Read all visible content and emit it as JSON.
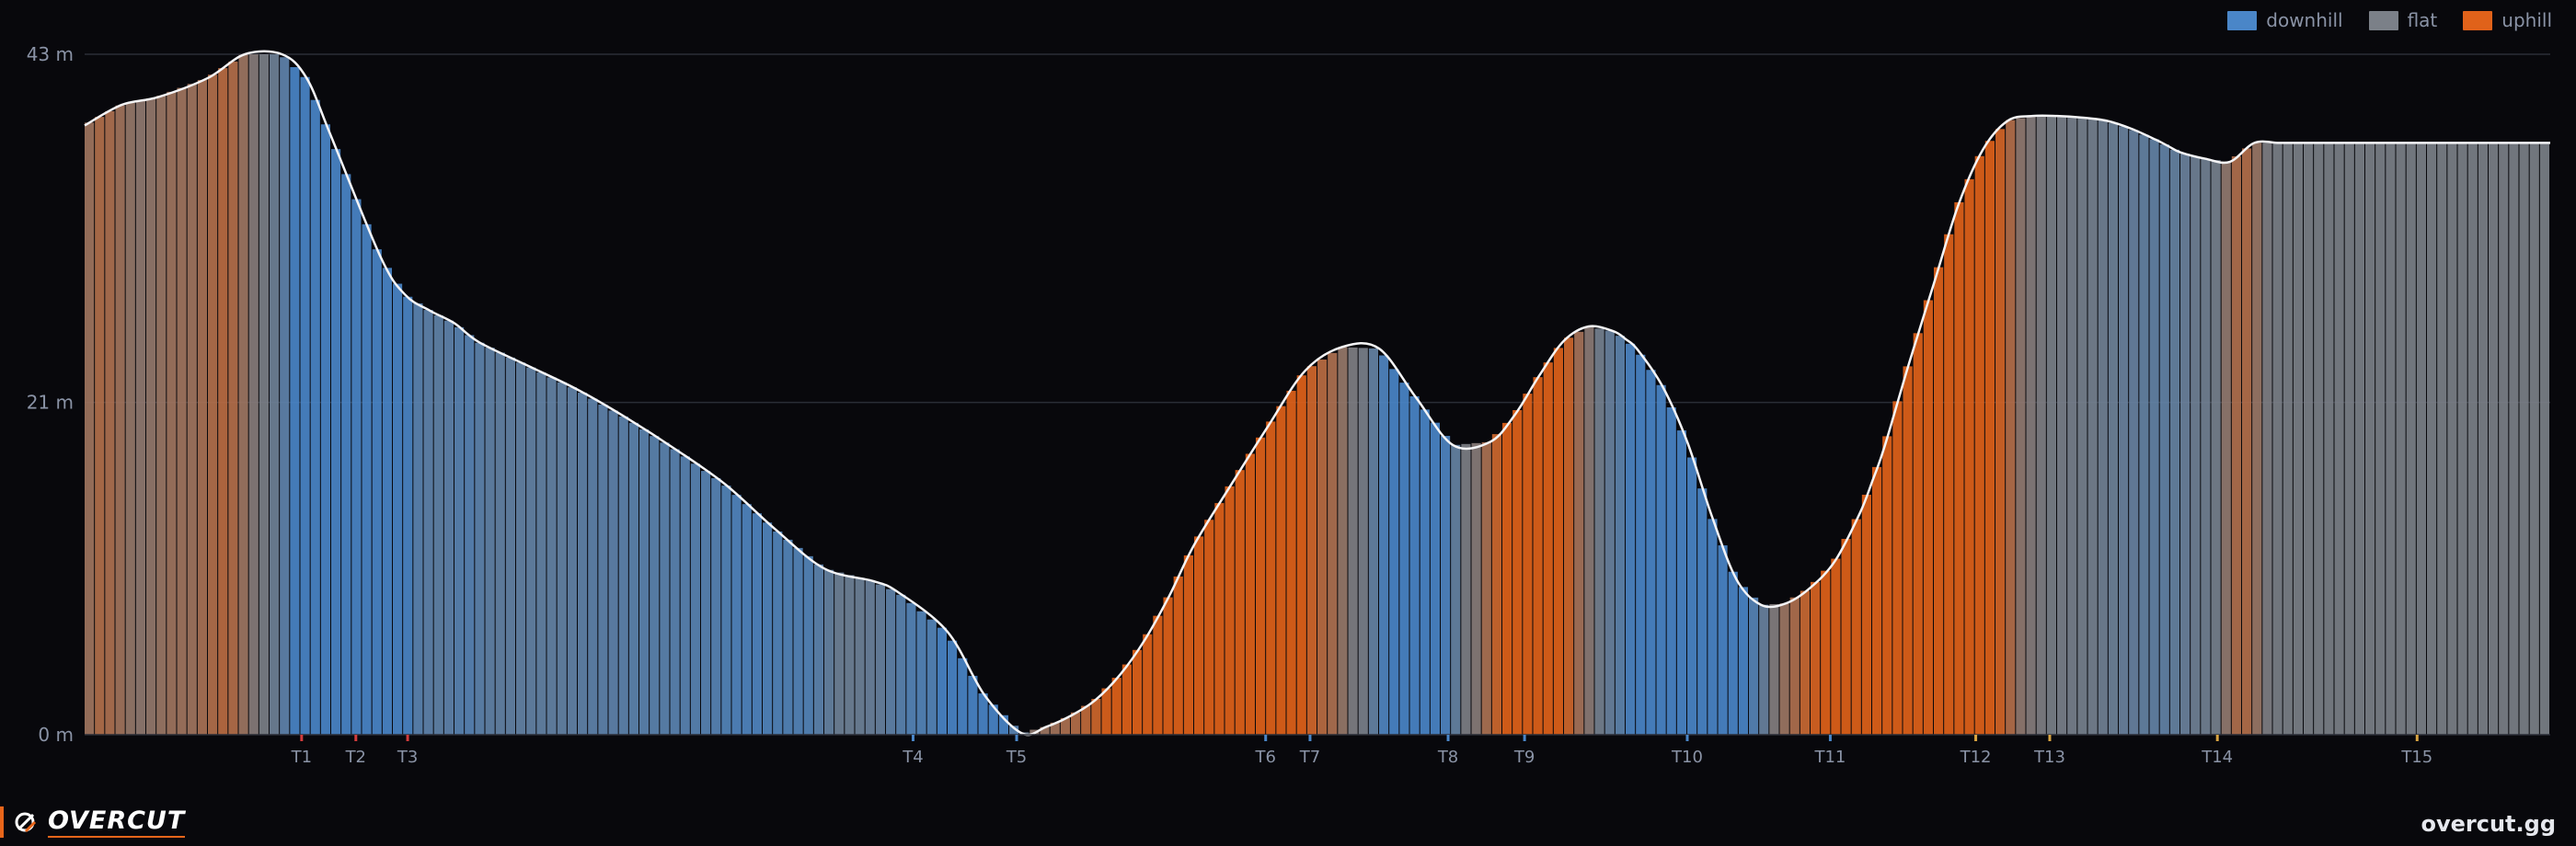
{
  "chart_data": {
    "type": "area",
    "ylim": [
      0,
      43
    ],
    "y_ticks": [
      {
        "value": 0,
        "label": "0 m"
      },
      {
        "value": 21,
        "label": "21 m"
      },
      {
        "value": 43,
        "label": "43 m"
      }
    ],
    "legend": [
      {
        "name": "downhill",
        "color": "#4a86c8"
      },
      {
        "name": "flat",
        "color": "#7b8088"
      },
      {
        "name": "uphill",
        "color": "#e0621a"
      }
    ],
    "legend_position": "top-right",
    "gridlines": true,
    "x_range": [
      0,
      100
    ],
    "profile_x": [
      0,
      1.5,
      3,
      5,
      6.5,
      8,
      9,
      10,
      12,
      13,
      14,
      15,
      16,
      18,
      20,
      22,
      24,
      26,
      28,
      30,
      32,
      33,
      35,
      36.5,
      38,
      39,
      40,
      41,
      42,
      43,
      44,
      45,
      46.5,
      48,
      49.5,
      51,
      52.5,
      54,
      55.5,
      57,
      58,
      59,
      60,
      61,
      62,
      62.5,
      63,
      64,
      65,
      66,
      67,
      68,
      69,
      70,
      71,
      72,
      72.5,
      73,
      74,
      75,
      76,
      77,
      78,
      79,
      80,
      81,
      82,
      83,
      84,
      84.5,
      85,
      86,
      87,
      88,
      89,
      90,
      91,
      92,
      93,
      94,
      95,
      96,
      97,
      98,
      99,
      100
    ],
    "profile_y": [
      38.5,
      39.8,
      40.3,
      41.5,
      43.0,
      43.0,
      41.5,
      37.8,
      30.2,
      27.8,
      26.8,
      26.0,
      24.8,
      23.3,
      21.8,
      20.0,
      18.0,
      15.8,
      13.0,
      10.5,
      9.7,
      9.0,
      6.5,
      2.5,
      0.1,
      0.5,
      1.2,
      2.2,
      3.8,
      6.0,
      8.8,
      12.0,
      15.8,
      19.5,
      23.0,
      24.5,
      24.4,
      21.3,
      18.3,
      18.5,
      20.2,
      22.7,
      24.9,
      25.8,
      25.5,
      25.0,
      24.3,
      22.0,
      18.5,
      13.8,
      9.8,
      8.2,
      8.3,
      9.3,
      11.0,
      14.0,
      16.0,
      18.2,
      23.5,
      28.5,
      33.5,
      37.0,
      38.8,
      39.1,
      39.1,
      39.0,
      38.8,
      38.3,
      37.6,
      37.2,
      36.8,
      36.4,
      36.2,
      37.4,
      37.4,
      37.4,
      37.4,
      37.4,
      37.4,
      37.4,
      37.4,
      37.4,
      37.4,
      37.4,
      37.4,
      37.4
    ],
    "x_markers": [
      {
        "label": "T1",
        "x": 8.8,
        "color": "#d23c3c"
      },
      {
        "label": "T2",
        "x": 11.0,
        "color": "#d23c3c"
      },
      {
        "label": "T3",
        "x": 13.1,
        "color": "#d23c3c"
      },
      {
        "label": "T4",
        "x": 33.6,
        "color": "#4a86c8"
      },
      {
        "label": "T5",
        "x": 37.8,
        "color": "#4a86c8"
      },
      {
        "label": "T6",
        "x": 47.9,
        "color": "#4a86c8"
      },
      {
        "label": "T7",
        "x": 49.7,
        "color": "#4a86c8"
      },
      {
        "label": "T8",
        "x": 55.3,
        "color": "#4a86c8"
      },
      {
        "label": "T9",
        "x": 58.4,
        "color": "#4a86c8"
      },
      {
        "label": "T10",
        "x": 65.0,
        "color": "#4a86c8"
      },
      {
        "label": "T11",
        "x": 70.8,
        "color": "#4a86c8"
      },
      {
        "label": "T12",
        "x": 76.7,
        "color": "#d9a441"
      },
      {
        "label": "T13",
        "x": 79.7,
        "color": "#d9a441"
      },
      {
        "label": "T14",
        "x": 86.5,
        "color": "#d9a441"
      },
      {
        "label": "T15",
        "x": 94.6,
        "color": "#d9a441"
      }
    ]
  },
  "brand": {
    "name": "OVERCUT",
    "site": "overcut.gg",
    "accent": "#e8651a"
  }
}
